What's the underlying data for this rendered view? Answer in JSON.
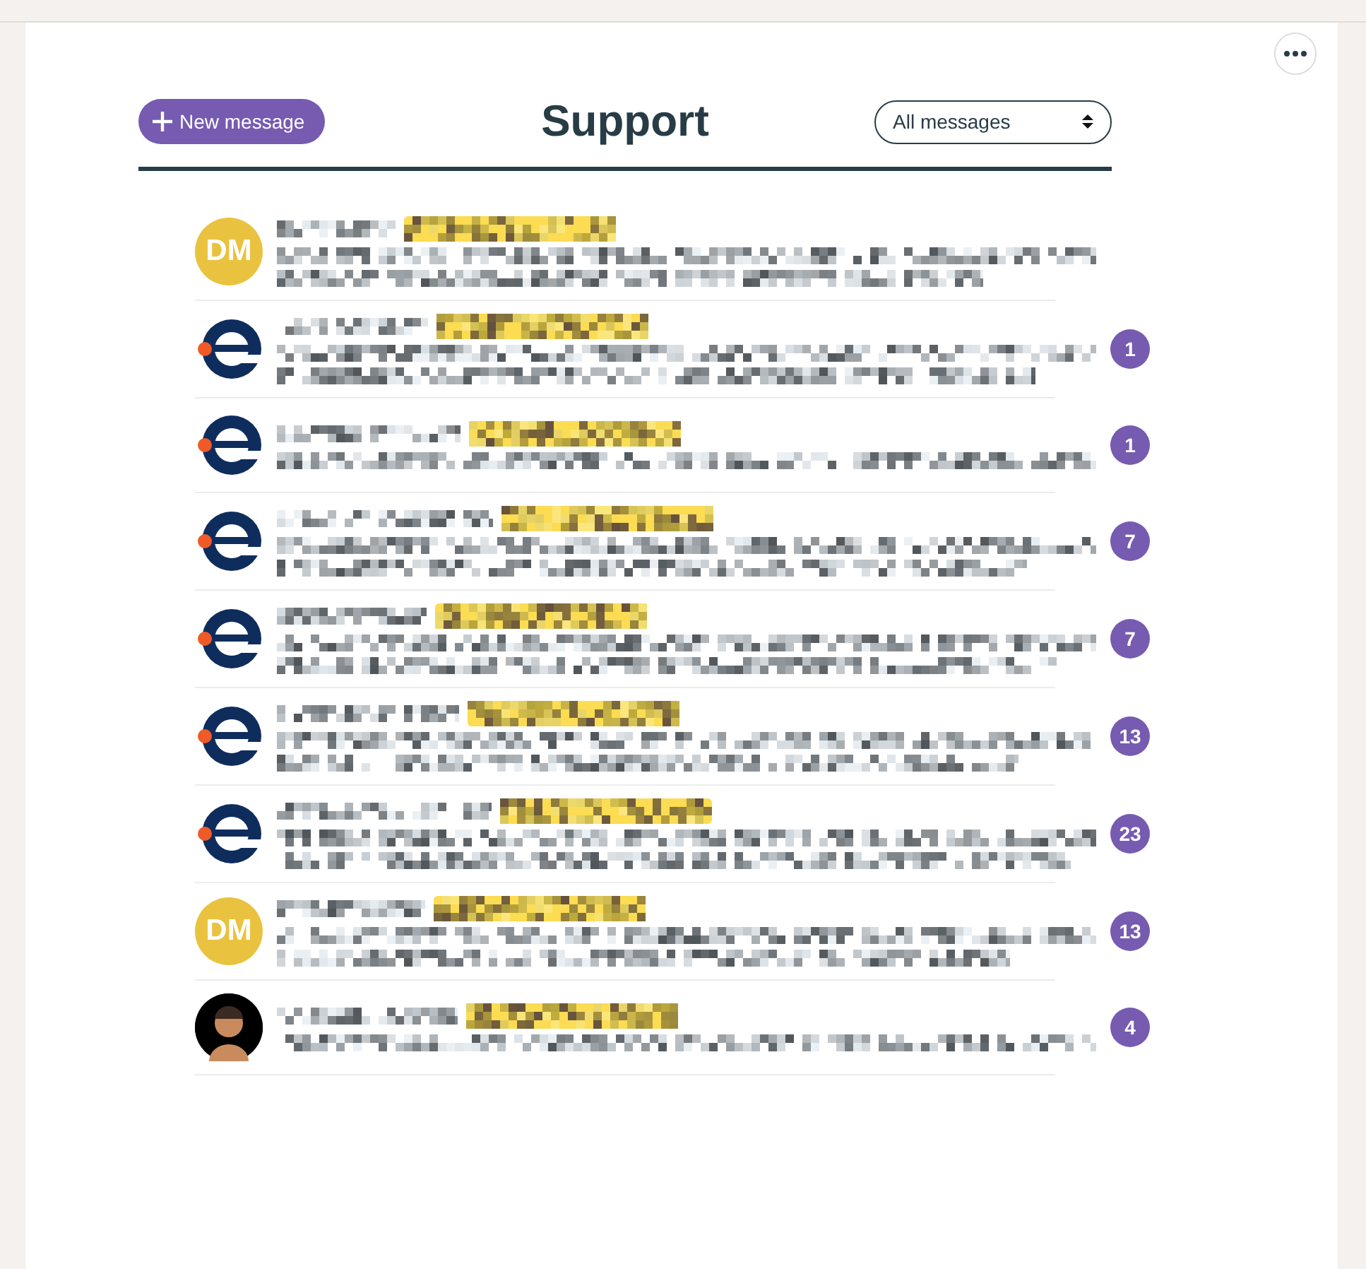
{
  "header": {
    "new_button": "New message",
    "title": "Support",
    "filter": "All messages"
  },
  "messages": [
    {
      "avatar": {
        "kind": "initials",
        "text": "DM",
        "color": "#e9c33f"
      },
      "preview": {
        "kind": "double"
      }
    },
    {
      "avatar": {
        "kind": "logo"
      },
      "preview": {
        "kind": "double"
      },
      "count": "1"
    },
    {
      "avatar": {
        "kind": "logo"
      },
      "preview": {
        "kind": "single"
      },
      "count": "1"
    },
    {
      "avatar": {
        "kind": "logo"
      },
      "preview": {
        "kind": "double"
      },
      "count": "7"
    },
    {
      "avatar": {
        "kind": "logo"
      },
      "preview": {
        "kind": "double"
      },
      "count": "7"
    },
    {
      "avatar": {
        "kind": "logo"
      },
      "preview": {
        "kind": "double"
      },
      "count": "13"
    },
    {
      "avatar": {
        "kind": "logo"
      },
      "preview": {
        "kind": "double"
      },
      "count": "23"
    },
    {
      "avatar": {
        "kind": "initials",
        "text": "DM",
        "color": "#e9c33f"
      },
      "preview": {
        "kind": "double"
      },
      "count": "13"
    },
    {
      "avatar": {
        "kind": "person"
      },
      "preview": {
        "kind": "single"
      },
      "count": "4"
    }
  ]
}
